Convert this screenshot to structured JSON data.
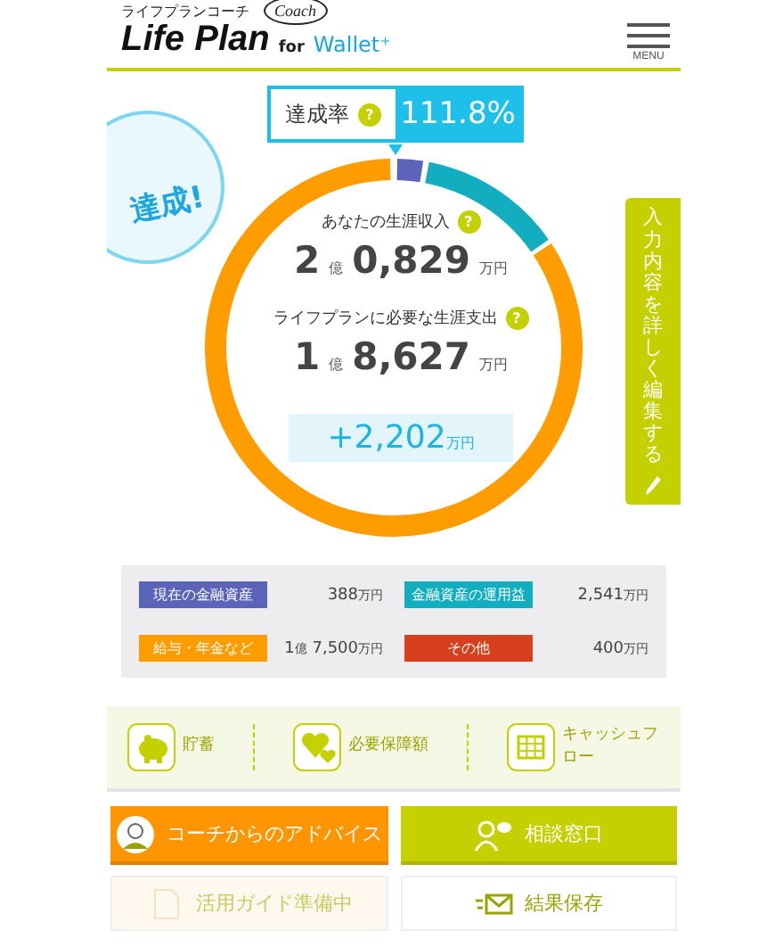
{
  "header": {
    "logo_kana": "ライフプランコーチ",
    "logo": "Life Plan",
    "logo_badge": "Coach",
    "logo_for": "for",
    "logo_partner": "Wallet⁺",
    "menu_label": "MENU"
  },
  "rate": {
    "label": "達成率",
    "help": "?",
    "value": "111.8%"
  },
  "stamp": "達成!",
  "summary": {
    "income_label": "あなたの生涯収入",
    "income_help": "?",
    "income_oku": "2",
    "income_oku_unit": "億",
    "income_man": "0,829",
    "income_unit": "万円",
    "expense_label": "ライフプランに必要な生涯支出",
    "expense_help": "?",
    "expense_oku": "1",
    "expense_oku_unit": "億",
    "expense_man": "8,627",
    "expense_unit": "万円",
    "diff": "+2,202",
    "diff_unit": "万円"
  },
  "edit_button": "入力内容を詳しく編集する",
  "legend": [
    {
      "label": "現在の金融資産",
      "color": "#5b64b8",
      "value": "388",
      "unit": "万円"
    },
    {
      "label": "金融資産の運用益",
      "color": "#12aec0",
      "value": "2,541",
      "unit": "万円"
    },
    {
      "label": "給与・年金など",
      "color": "#ff9c00",
      "oku": "1",
      "oku_unit": "億",
      "value": "7,500",
      "unit": "万円"
    },
    {
      "label": "その他",
      "color": "#d6401c",
      "value": "400",
      "unit": "万円"
    }
  ],
  "nav": [
    {
      "kind": "piggy",
      "label": "貯蓄"
    },
    {
      "kind": "hearts",
      "label": "必要保障額"
    },
    {
      "kind": "table",
      "label": "キャッシュフロー"
    }
  ],
  "actions": [
    {
      "kind": "advice",
      "label": "コーチからのアドバイス",
      "disabled": false
    },
    {
      "kind": "consult",
      "label": "相談窓口",
      "disabled": false
    },
    {
      "kind": "guide",
      "label": "活用ガイド準備中",
      "disabled": true
    },
    {
      "kind": "save",
      "label": "結果保存",
      "disabled": false
    }
  ]
}
